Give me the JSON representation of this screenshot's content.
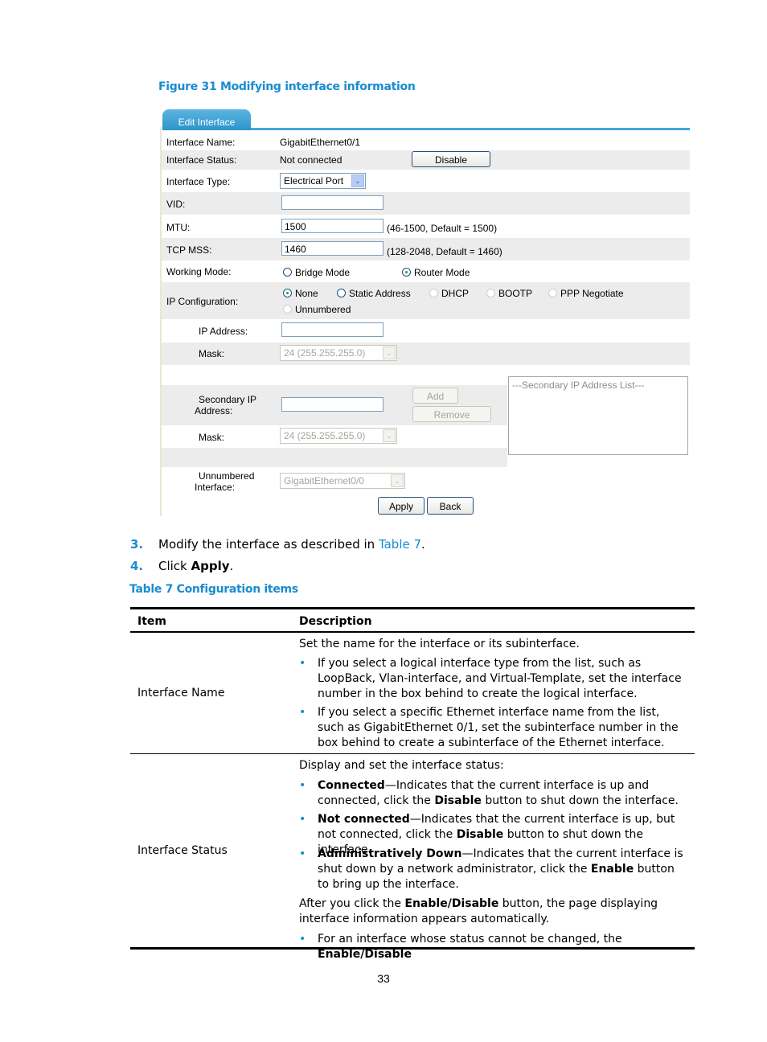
{
  "figure_caption": "Figure 31 Modifying interface information",
  "ui": {
    "tab_label": "Edit Interface",
    "interface_name_label": "Interface Name:",
    "interface_name_value": "GigabitEthernet0/1",
    "interface_status_label": "Interface Status:",
    "interface_status_value": "Not connected",
    "disable_button": "Disable",
    "interface_type_label": "Interface Type:",
    "interface_type_value": "Electrical Port",
    "vid_label": "VID:",
    "vid_value": "",
    "mtu_label": "MTU:",
    "mtu_value": "1500",
    "mtu_hint": "(46-1500, Default = 1500)",
    "tcpmss_label": "TCP MSS:",
    "tcpmss_value": "1460",
    "tcpmss_hint": "(128-2048, Default = 1460)",
    "working_mode_label": "Working Mode:",
    "working_modes": [
      {
        "label": "Bridge Mode",
        "selected": false
      },
      {
        "label": "Router Mode",
        "selected": true
      }
    ],
    "ip_config_label": "IP Configuration:",
    "ip_config_options": [
      {
        "label": "None",
        "selected": true,
        "enabled": true
      },
      {
        "label": "Static Address",
        "selected": false,
        "enabled": true
      },
      {
        "label": "DHCP",
        "selected": false,
        "enabled": false
      },
      {
        "label": "BOOTP",
        "selected": false,
        "enabled": false
      },
      {
        "label": "PPP Negotiate",
        "selected": false,
        "enabled": false
      },
      {
        "label": "Unnumbered",
        "selected": false,
        "enabled": false
      }
    ],
    "ip_address_label": "IP Address:",
    "ip_address_value": "",
    "mask_label": "Mask:",
    "mask_value": "24 (255.255.255.0)",
    "secondary_ip_label_1": "Secondary IP",
    "secondary_ip_label_2": "Address:",
    "secondary_ip_value": "",
    "add_button": "Add",
    "remove_button": "Remove",
    "secondary_list_placeholder": "---Secondary IP Address List---",
    "secondary_mask_label": "Mask:",
    "secondary_mask_value": "24 (255.255.255.0)",
    "unnumbered_label_1": "Unnumbered",
    "unnumbered_label_2": "Interface:",
    "unnumbered_value": "GigabitEthernet0/0",
    "apply_button": "Apply",
    "back_button": "Back"
  },
  "steps": [
    {
      "num": "3.",
      "pre": "Modify the interface as described in ",
      "link": "Table 7",
      "post": "."
    },
    {
      "num": "4.",
      "pre": "Click ",
      "bold": "Apply",
      "post": "."
    }
  ],
  "table_caption": "Table 7 Configuration items",
  "table": {
    "headers": [
      "Item",
      "Description"
    ],
    "rows": [
      {
        "item": "Interface Name",
        "intro": "Set the name for the interface or its subinterface.",
        "bullets": [
          "If you select a logical interface type from the list, such as LoopBack, Vlan-interface, and Virtual-Template, set the interface number in the box behind to create the logical interface.",
          "If you select a specific Ethernet interface name from the list, such as GigabitEthernet 0/1, set the subinterface number in the box behind to create a subinterface of the Ethernet interface."
        ]
      },
      {
        "item": "Interface Status",
        "intro": "Display and set the interface status:",
        "bullets": [
          {
            "term": "Connected",
            "text": "—Indicates that the current interface is up and connected, click the ",
            "b": "Disable",
            "tail": " button to shut down the interface."
          },
          {
            "term": "Not connected",
            "text": "—Indicates that the current interface is up, but not connected, click the ",
            "b": "Disable",
            "tail": " button to shut down the interface."
          },
          {
            "term": "Administratively Down",
            "text": "—Indicates that the current interface is shut down by a network administrator, click the ",
            "b": "Enable",
            "tail": " button to bring up the interface."
          }
        ],
        "after": {
          "pre": "After you click the ",
          "b1": "Enable",
          "sep": "/",
          "b2": "Disable",
          "post": " button, the page displaying interface information appears automatically."
        },
        "last_bullet": {
          "pre": "For an interface whose status cannot be changed, the ",
          "b1": "Enable",
          "sep": "/",
          "b2": "Disable"
        }
      }
    ]
  },
  "page_number": "33"
}
